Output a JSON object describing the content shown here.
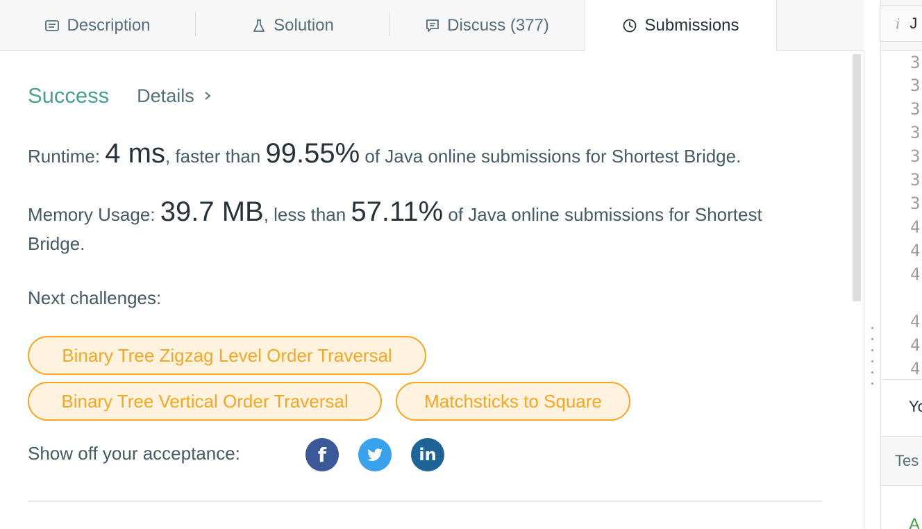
{
  "tabs": {
    "description": "Description",
    "solution": "Solution",
    "discuss": "Discuss (377)",
    "submissions": "Submissions"
  },
  "result": {
    "status": "Success",
    "details": "Details"
  },
  "runtime": {
    "label": "Runtime: ",
    "value": "4 ms",
    "middle": ", faster than ",
    "percent": "99.55%",
    "suffix": " of Java online submissions for Shortest Bridge."
  },
  "memory": {
    "label": "Memory Usage: ",
    "value": "39.7 MB",
    "middle": ", less than ",
    "percent": "57.11%",
    "suffix": " of Java online submissions for Shortest Bridge."
  },
  "next": {
    "label": "Next challenges:",
    "items": [
      "Binary Tree Zigzag Level Order Traversal",
      "Binary Tree Vertical Order Traversal",
      "Matchsticks to Square"
    ]
  },
  "share": {
    "label": "Show off your acceptance:",
    "icons": [
      "facebook-icon",
      "twitter-icon",
      "linkedin-icon"
    ]
  },
  "right_panel": {
    "lang_initial": "J",
    "line_numbers": [
      "3",
      "3",
      "3",
      "3",
      "3",
      "3",
      "3",
      "4",
      "4",
      "4",
      "4",
      "4",
      "4"
    ],
    "section1": "Yo",
    "section2": "Tes",
    "section3": "A"
  },
  "colors": {
    "success": "#4a9f8f",
    "challenge": "#f5a623",
    "facebook": "#3b5998",
    "twitter": "#3aa1ec",
    "linkedin": "#1f6497"
  }
}
